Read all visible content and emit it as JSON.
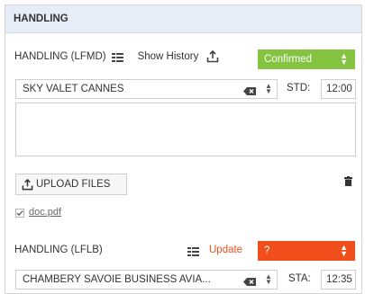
{
  "panel": {
    "title": "HANDLING"
  },
  "departure": {
    "label": "HANDLING (LFMD)",
    "show_history_label": "Show History",
    "status_value": "Confirmed",
    "status_color": "#84c441",
    "handler_value": "SKY VALET CANNES",
    "time_label": "STD:",
    "time_value": "12:00",
    "notes_value": "",
    "upload_label": "UPLOAD FILES",
    "files": [
      {
        "name": "doc.pdf",
        "checked": true
      }
    ]
  },
  "arrival": {
    "label": "HANDLING (LFLB)",
    "update_label": "Update",
    "update_color": "#e8521d",
    "status_value": "?",
    "status_color": "#f04e1b",
    "handler_value": "CHAMBERY SAVOIE BUSINESS AVIA...",
    "time_label": "STA:",
    "time_value": "12:35"
  },
  "icons": [
    "list-icon",
    "upload-icon",
    "trash-icon",
    "clear-icon",
    "spinner-icon",
    "chevron-updown-icon",
    "checkbox-icon"
  ]
}
